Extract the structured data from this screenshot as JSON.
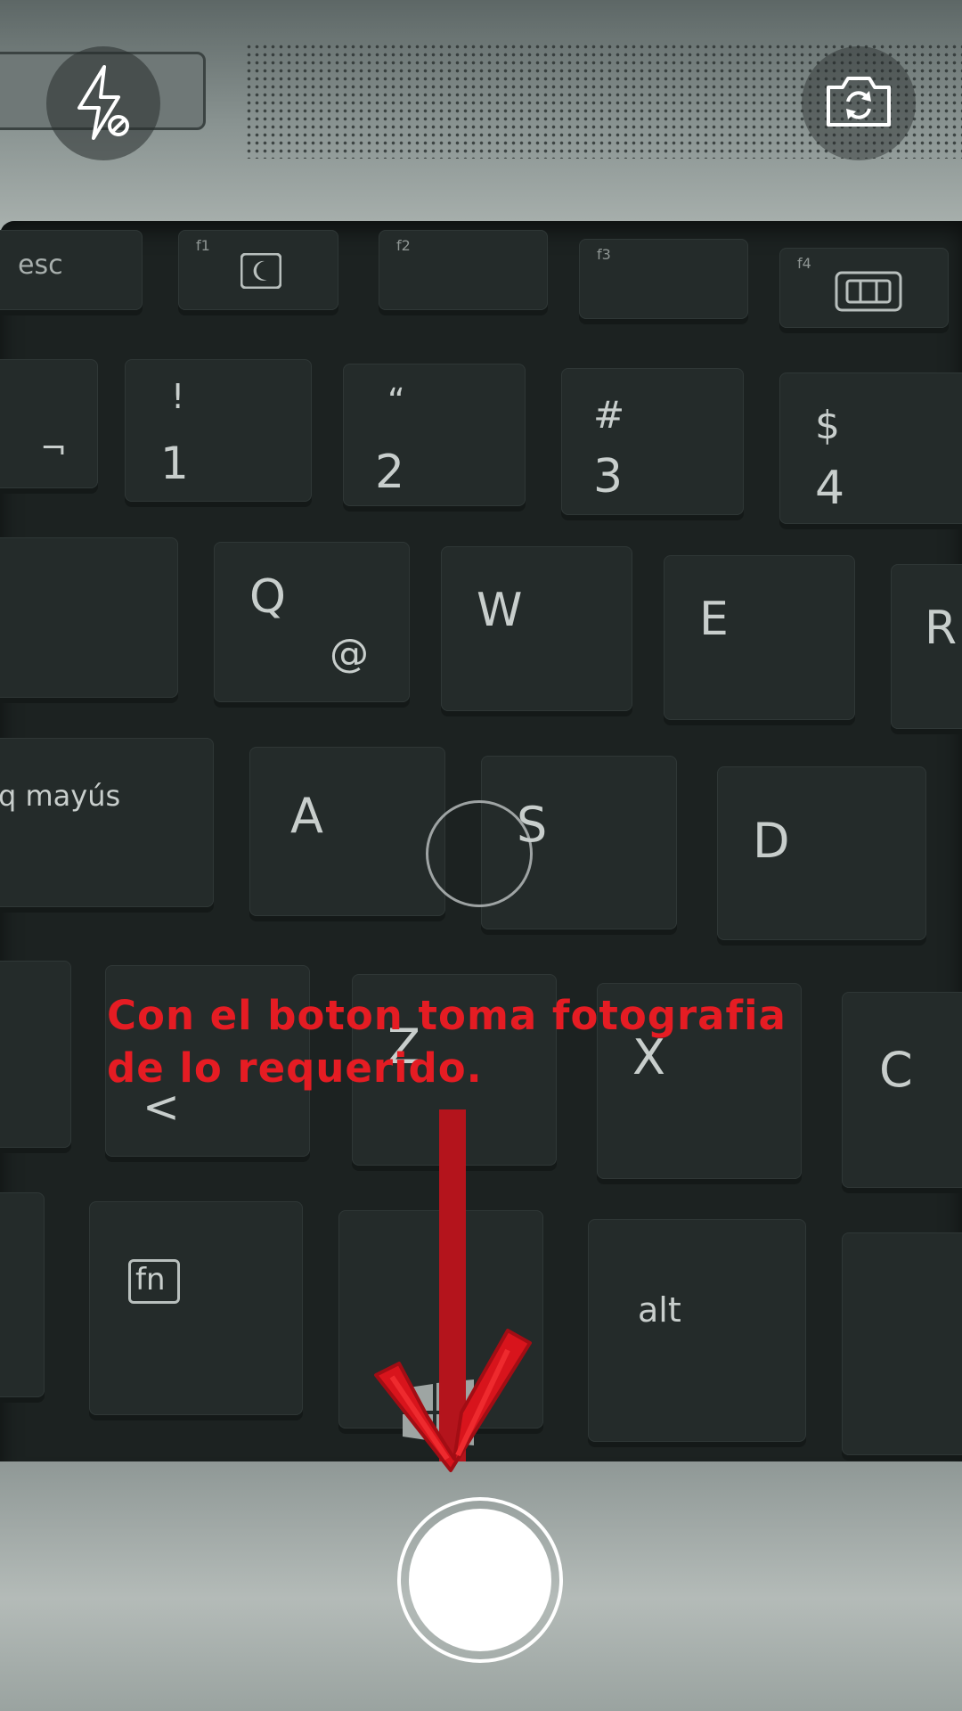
{
  "camera": {
    "flash_mode": "off",
    "controls": {
      "flash_icon": "flash-off-icon",
      "switch_camera_icon": "camera-switch-icon",
      "shutter_icon": "shutter-icon"
    }
  },
  "instruction": {
    "line1": "Con el boton toma fotografia",
    "line2": "de lo requerido.",
    "color": "#e51c23"
  },
  "annotation": {
    "arrow_icon": "down-arrow-icon",
    "arrow_color": "#c8141c"
  },
  "viewfinder_scene": {
    "keys": {
      "esc": "esc",
      "f1": "f1",
      "f2": "f2",
      "f3": "f3",
      "f4": "f4",
      "excl": "!",
      "one": "1",
      "quote": "“",
      "two": "2",
      "hash": "#",
      "three": "3",
      "dollar": "$",
      "four": "4",
      "q": "Q",
      "at": "@",
      "w": "W",
      "e": "E",
      "r": "R",
      "caps": "q mayús",
      "a": "A",
      "s": "S",
      "d": "D",
      "lt": "<",
      "z": "Z",
      "x": "X",
      "c": "C",
      "fn": "fn",
      "alt": "alt",
      "not": "¬"
    }
  }
}
